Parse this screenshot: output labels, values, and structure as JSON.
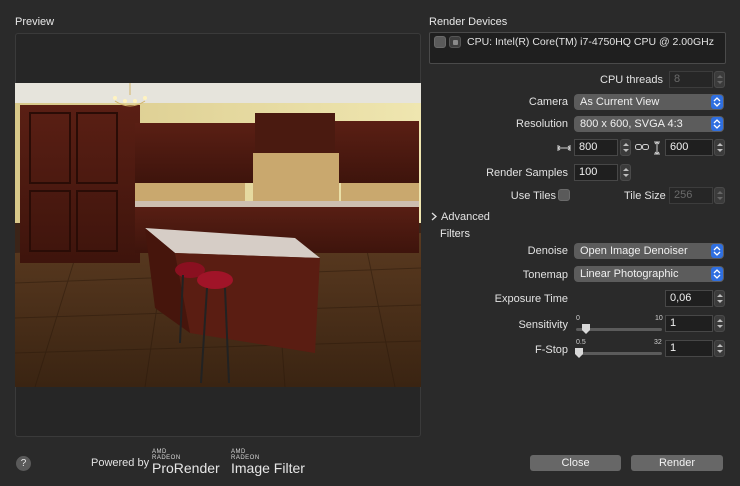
{
  "preview": {
    "title": "Preview"
  },
  "devices": {
    "title": "Render Devices",
    "items": [
      {
        "label": "CPU: Intel(R) Core(TM) i7-4750HQ CPU @ 2.00GHz"
      }
    ]
  },
  "settings": {
    "cpu_threads": {
      "label": "CPU threads",
      "value": "8"
    },
    "camera": {
      "label": "Camera",
      "value": "As Current View"
    },
    "resolution": {
      "label": "Resolution",
      "value": "800 x 600, SVGA 4:3"
    },
    "width": {
      "value": "800"
    },
    "height": {
      "value": "600"
    },
    "render_samples": {
      "label": "Render Samples",
      "value": "100"
    },
    "use_tiles": {
      "label": "Use Tiles"
    },
    "tile_size": {
      "label": "Tile Size",
      "value": "256"
    },
    "advanced": {
      "label": "Advanced"
    },
    "filters": {
      "title": "Filters"
    },
    "denoise": {
      "label": "Denoise",
      "value": "Open Image Denoiser"
    },
    "tonemap": {
      "label": "Tonemap",
      "value": "Linear Photographic"
    },
    "exposure_time": {
      "label": "Exposure Time",
      "value": "0,06"
    },
    "sensitivity": {
      "label": "Sensitivity",
      "value": "1",
      "min": "0",
      "max": "10"
    },
    "fstop": {
      "label": "F-Stop",
      "value": "1",
      "min": "0.5",
      "max": "32"
    }
  },
  "footer": {
    "help": "?",
    "powered_by": "Powered by",
    "logo1": {
      "small1": "AMD",
      "small2": "RADEON",
      "big": "ProRender"
    },
    "logo2": {
      "small1": "AMD",
      "small2": "RADEON",
      "big": "Image Filter"
    },
    "close_label": "Close",
    "render_label": "Render"
  },
  "colors": {
    "accent": "#2f6fe0",
    "background": "#2a2a2a"
  }
}
